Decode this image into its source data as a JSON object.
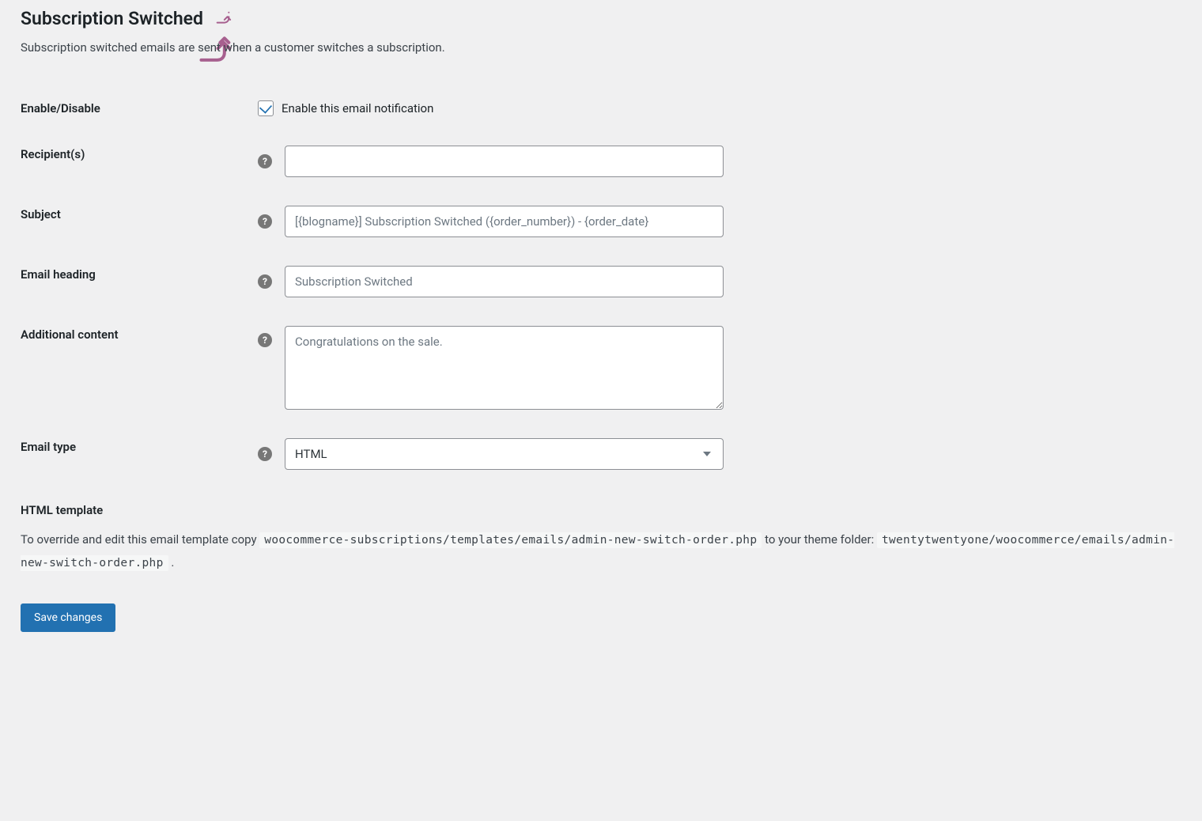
{
  "header": {
    "title": "Subscription Switched",
    "description": "Subscription switched emails are sent when a customer switches a subscription."
  },
  "fields": {
    "enable": {
      "label": "Enable/Disable",
      "checkbox_label": "Enable this email notification",
      "checked": true
    },
    "recipients": {
      "label": "Recipient(s)",
      "value": "",
      "placeholder": ""
    },
    "subject": {
      "label": "Subject",
      "value": "",
      "placeholder": "[{blogname}] Subscription Switched ({order_number}) - {order_date}"
    },
    "heading": {
      "label": "Email heading",
      "value": "",
      "placeholder": "Subscription Switched"
    },
    "additional": {
      "label": "Additional content",
      "value": "",
      "placeholder": "Congratulations on the sale."
    },
    "email_type": {
      "label": "Email type",
      "value": "HTML"
    }
  },
  "template": {
    "heading": "HTML template",
    "text_prefix": "To override and edit this email template copy ",
    "code1": "woocommerce-subscriptions/templates/emails/admin-new-switch-order.php",
    "text_mid": " to your theme folder: ",
    "code2": "twentytwentyone/woocommerce/emails/admin-new-switch-order.php",
    "text_suffix": " ."
  },
  "actions": {
    "save": "Save changes"
  }
}
